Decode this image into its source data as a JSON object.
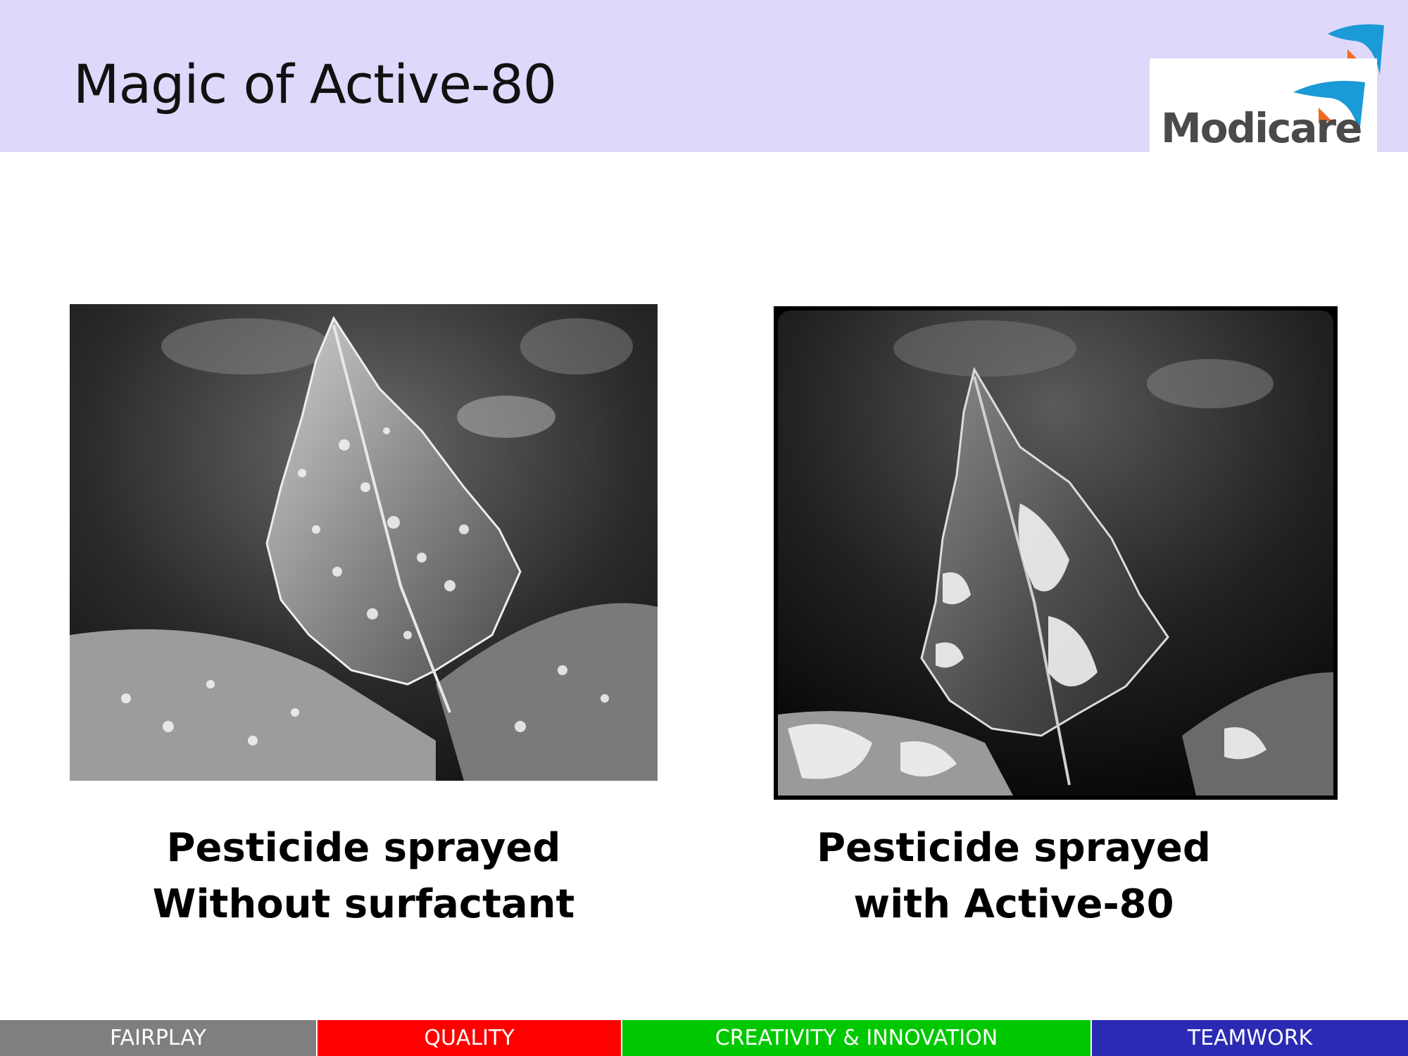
{
  "slide": {
    "title": "Magic of Active-80"
  },
  "logo": {
    "text": "Modicare",
    "icon": "modicare-swoosh-logo"
  },
  "panels": [
    {
      "image_description_icon": "leaf-with-water-droplets-photo",
      "caption_line1": "Pesticide sprayed",
      "caption_line2": "Without surfactant"
    },
    {
      "image_description_icon": "leaf-with-spread-film-photo",
      "caption_line1": "Pesticide sprayed",
      "caption_line2": "with Active-80"
    }
  ],
  "footer": {
    "items": [
      {
        "label": "FAIRPLAY",
        "color": "#7f7f7f"
      },
      {
        "label": "QUALITY",
        "color": "#ff0000"
      },
      {
        "label": "CREATIVITY & INNOVATION",
        "color": "#00c800"
      },
      {
        "label": "TEAMWORK",
        "color": "#2a2ab4"
      }
    ]
  },
  "colors": {
    "header_bg": "#dfd8fb",
    "logo_blue": "#1a9ad6",
    "logo_orange": "#f26a21"
  }
}
